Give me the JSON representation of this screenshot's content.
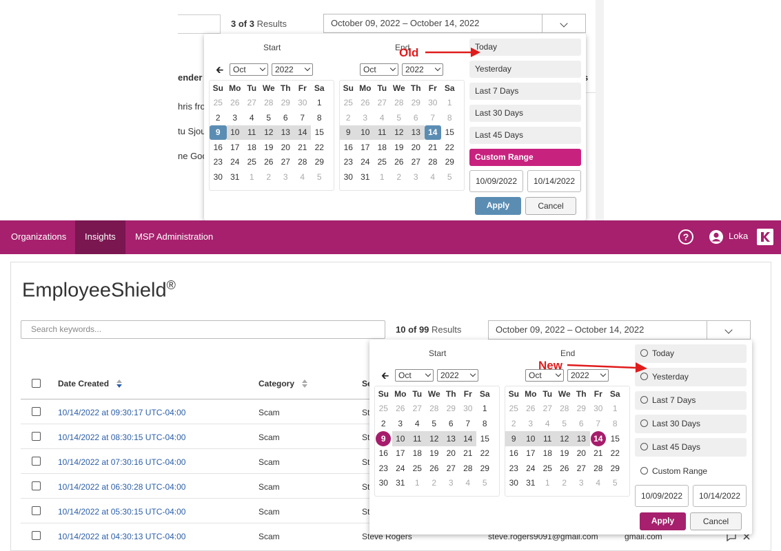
{
  "old": {
    "results_count": "3 of 3",
    "results_label": "Results",
    "date_range": "October 09, 2022  –  October 14, 2022",
    "table_fragments": [
      "ender",
      "hris fro",
      "tu Sjou",
      "ne Goo",
      "s"
    ],
    "start_label": "Start",
    "end_label": "End",
    "annotation": "Old",
    "start_month": "Oct",
    "start_year": "2022",
    "end_month": "Oct",
    "end_year": "2022",
    "ranges": [
      "Today",
      "Yesterday",
      "Last 7 Days",
      "Last 30 Days",
      "Last 45 Days",
      "Custom Range"
    ],
    "from_date": "10/09/2022",
    "to_date": "10/14/2022",
    "apply_label": "Apply",
    "cancel_label": "Cancel"
  },
  "nav": {
    "items": [
      "Organizations",
      "Insights",
      "MSP Administration"
    ],
    "user": "Loka"
  },
  "page": {
    "title": "EmployeeShield",
    "title_mark": "®",
    "search_placeholder": "Search keywords...",
    "results_count": "10 of 99",
    "results_label": "Results",
    "date_range": "October 09, 2022  –  October 14, 2022"
  },
  "new": {
    "start_label": "Start",
    "end_label": "End",
    "annotation": "New",
    "start_month": "Oct",
    "start_year": "2022",
    "end_month": "Oct",
    "end_year": "2022",
    "ranges": [
      "Today",
      "Yesterday",
      "Last 7 Days",
      "Last 30 Days",
      "Last 45 Days",
      "Custom Range"
    ],
    "from_date": "10/09/2022",
    "to_date": "10/14/2022",
    "apply_label": "Apply",
    "cancel_label": "Cancel"
  },
  "calendar": {
    "weekdays": [
      "Su",
      "Mo",
      "Tu",
      "We",
      "Th",
      "Fr",
      "Sa"
    ],
    "weeks": [
      [
        "25",
        "26",
        "27",
        "28",
        "29",
        "30",
        "1"
      ],
      [
        "2",
        "3",
        "4",
        "5",
        "6",
        "7",
        "8"
      ],
      [
        "9",
        "10",
        "11",
        "12",
        "13",
        "14",
        "15"
      ],
      [
        "16",
        "17",
        "18",
        "19",
        "20",
        "21",
        "22"
      ],
      [
        "23",
        "24",
        "25",
        "26",
        "27",
        "28",
        "29"
      ],
      [
        "30",
        "31",
        "1",
        "2",
        "3",
        "4",
        "5"
      ]
    ]
  },
  "table": {
    "headers": {
      "date": "Date Created",
      "category": "Category",
      "sender_fragment": "Se",
      "end_fragment": "s"
    },
    "rows": [
      {
        "date": "10/14/2022 at 09:30:17 UTC-04:00",
        "category": "Scam",
        "sender": "St"
      },
      {
        "date": "10/14/2022 at 08:30:15 UTC-04:00",
        "category": "Scam",
        "sender": "St"
      },
      {
        "date": "10/14/2022 at 07:30:16 UTC-04:00",
        "category": "Scam",
        "sender": "St"
      },
      {
        "date": "10/14/2022 at 06:30:28 UTC-04:00",
        "category": "Scam",
        "sender": "St"
      },
      {
        "date": "10/14/2022 at 05:30:15 UTC-04:00",
        "category": "Scam",
        "sender": "St"
      },
      {
        "date": "10/14/2022 at 04:30:13 UTC-04:00",
        "category": "Scam",
        "sender": "Steve Rogers",
        "email": "steve.rogers9091@gmail.com",
        "domain": "gmail.com"
      }
    ]
  },
  "colors": {
    "brand": "#a6206d",
    "brand_dark": "#7a1650",
    "old_accent": "#5b8db3",
    "link": "#2b5ea8",
    "annotation": "#e01b1b"
  }
}
